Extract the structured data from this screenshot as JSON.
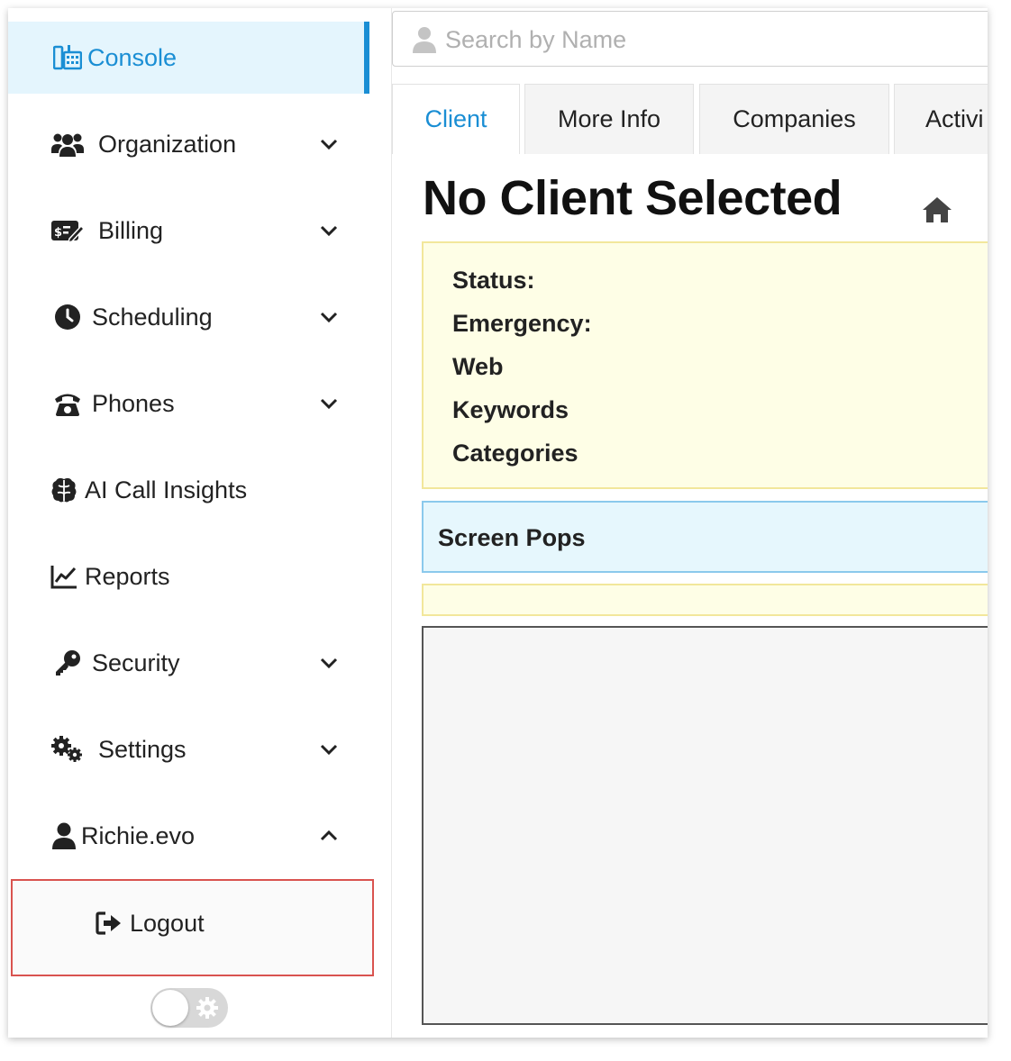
{
  "sidebar": {
    "items": [
      {
        "label": "Console",
        "icon": "console-icon",
        "active": true,
        "expandable": false
      },
      {
        "label": "Organization",
        "icon": "users-icon",
        "expandable": true,
        "chevron": "chevron-down"
      },
      {
        "label": "Billing",
        "icon": "money-check-icon",
        "expandable": true,
        "chevron": "chevron-down"
      },
      {
        "label": "Scheduling",
        "icon": "clock-icon",
        "expandable": true,
        "chevron": "chevron-down"
      },
      {
        "label": "Phones",
        "icon": "phone-icon",
        "expandable": true,
        "chevron": "chevron-down"
      },
      {
        "label": "AI Call Insights",
        "icon": "brain-icon",
        "expandable": false
      },
      {
        "label": "Reports",
        "icon": "chart-line-icon",
        "expandable": false
      },
      {
        "label": "Security",
        "icon": "key-icon",
        "expandable": true,
        "chevron": "chevron-down"
      },
      {
        "label": "Settings",
        "icon": "gears-icon",
        "expandable": true,
        "chevron": "chevron-down"
      },
      {
        "label": "Richie.evo",
        "icon": "user-icon",
        "expandable": true,
        "chevron": "chevron-up"
      }
    ],
    "logout_label": "Logout",
    "theme_toggle": {
      "state": "off",
      "icon": "gear-icon"
    }
  },
  "search": {
    "placeholder": "Search by Name",
    "value": ""
  },
  "tabs": [
    {
      "label": "Client",
      "active": true
    },
    {
      "label": "More Info",
      "active": false
    },
    {
      "label": "Companies",
      "active": false
    },
    {
      "label": "Activi",
      "active": false
    }
  ],
  "main": {
    "title": "No Client Selected",
    "info_lines": [
      "Status:",
      "Emergency:",
      "Web",
      "Keywords",
      "Categories"
    ],
    "screen_pops_label": "Screen Pops"
  },
  "colors": {
    "accent": "#1a8ed4",
    "active_bg": "#e4f5fd",
    "info_bg": "#fefee6",
    "info_border": "#f2e79b",
    "pops_bg": "#e6f7fd",
    "pops_border": "#8bc9ec",
    "logout_highlight": "#d9534f"
  }
}
